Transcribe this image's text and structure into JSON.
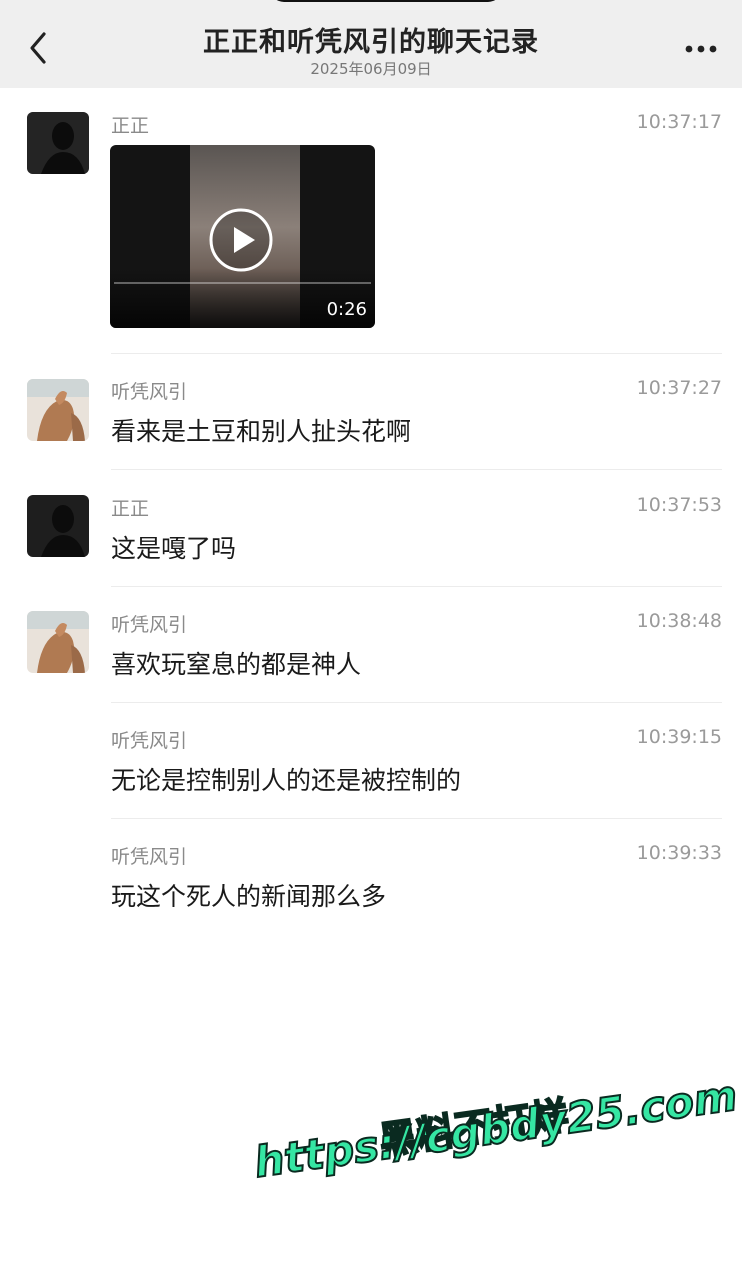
{
  "header": {
    "title": "正正和听凭风引的聊天记录",
    "date": "2025年06月09日"
  },
  "messages": [
    {
      "sender": "正正",
      "time": "10:37:17",
      "type": "video",
      "duration": "0:26",
      "avatar": "dark"
    },
    {
      "sender": "听凭风引",
      "time": "10:37:27",
      "text": "看来是土豆和别人扯头花啊",
      "avatar": "light"
    },
    {
      "sender": "正正",
      "time": "10:37:53",
      "text": "这是嘎了吗",
      "avatar": "dark"
    },
    {
      "sender": "听凭风引",
      "time": "10:38:48",
      "text": "喜欢玩窒息的都是神人",
      "avatar": "light"
    },
    {
      "sender": "听凭风引",
      "time": "10:39:15",
      "text": "无论是控制别人的还是被控制的"
    },
    {
      "sender": "听凭风引",
      "time": "10:39:33",
      "text": "玩这个死人的新闻那么多"
    }
  ],
  "watermark": {
    "line1": "黑料不打烊",
    "line2": "https://cgbdy25.com"
  },
  "colors": {
    "header_bg": "#efefef",
    "watermark_fill": "#35e6a3"
  }
}
